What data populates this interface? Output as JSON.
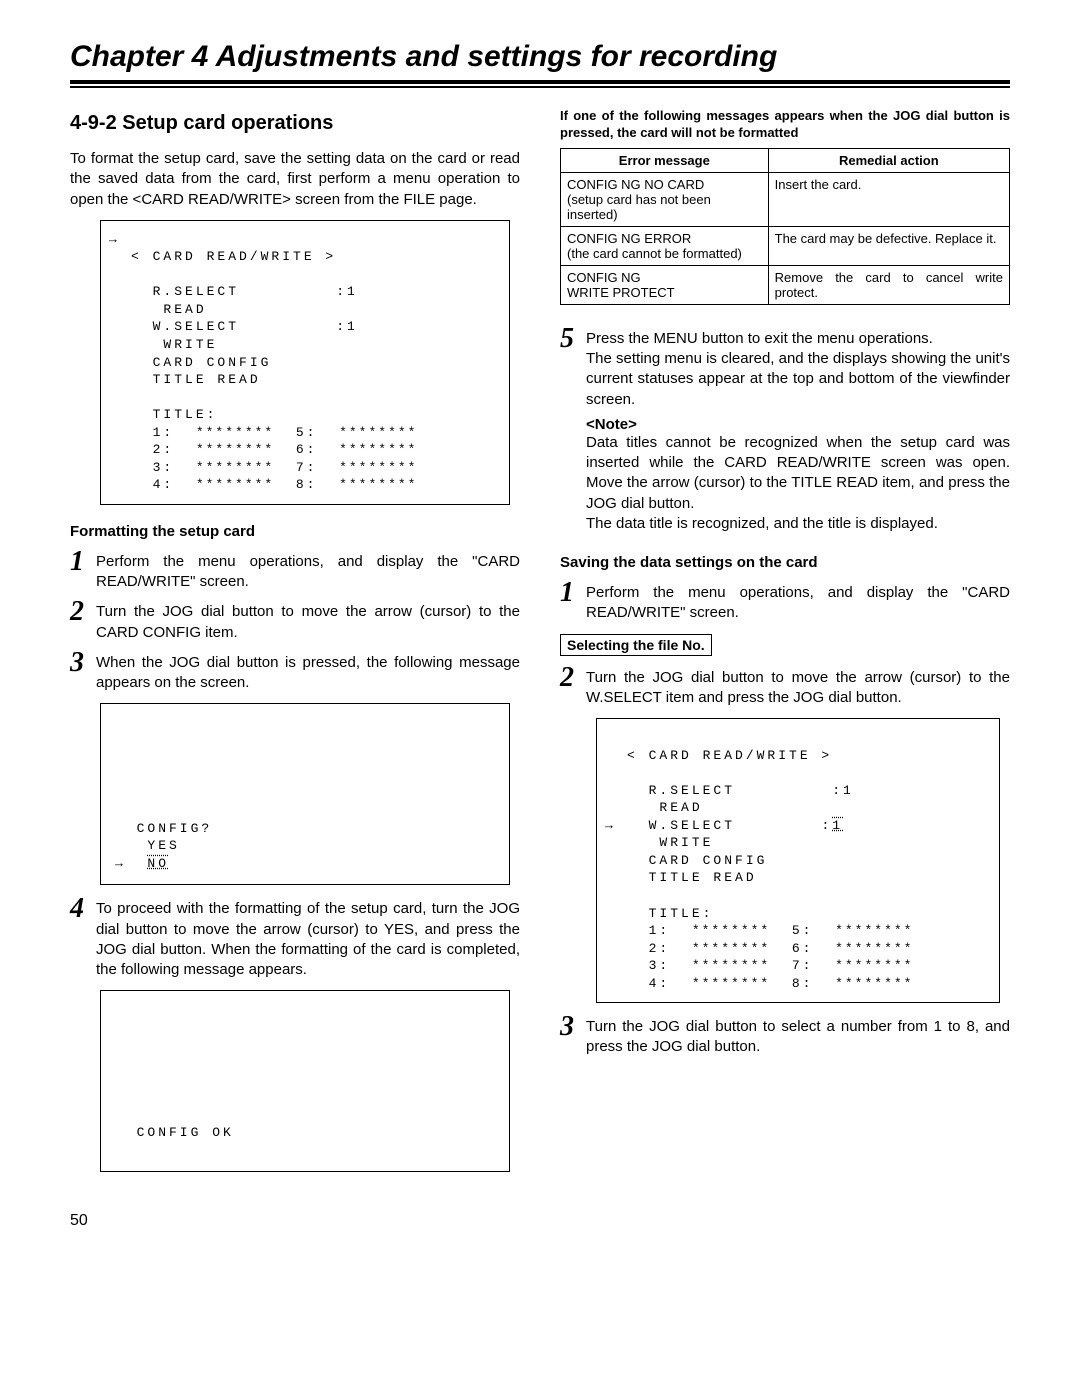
{
  "chapter": "Chapter 4  Adjustments and settings for recording",
  "section": "4-9-2 Setup card operations",
  "intro": "To format the setup card, save the setting data on the card or read the saved data from the card, first perform a menu operation to open the <CARD READ/WRITE> screen from the FILE page.",
  "screen1": {
    "line0": "→< CARD READ/WRITE >",
    "l1": "R.SELECT",
    "v1": ":1",
    "l2": " READ",
    "l3": "W.SELECT",
    "v3": ":1",
    "l4": " WRITE",
    "l5": "CARD CONFIG",
    "l6": "TITLE READ",
    "title": "TITLE:",
    "row1l": "1:  ",
    "ast": "********",
    "row1r": "5:  ",
    "row2l": "2:  ",
    "row2r": "6:  ",
    "row3l": "3:  ",
    "row3r": "7:  ",
    "row4l": "4:  ",
    "row4r": "8:  "
  },
  "fmt_head": "Formatting the setup card",
  "steps_left": {
    "s1": {
      "n": "1",
      "t": "Perform the menu operations, and display the \"CARD READ/WRITE\" screen."
    },
    "s2": {
      "n": "2",
      "t": "Turn the JOG dial button to move the arrow (cursor) to the CARD CONFIG item."
    },
    "s3": {
      "n": "3",
      "t": "When the JOG dial button is pressed, the following message appears on the screen."
    },
    "s4": {
      "n": "4",
      "t": "To proceed with the formatting of the setup card, turn the JOG dial button to move the arrow (cursor) to YES, and press the JOG dial button.  When the formatting of the card is completed, the following message appears."
    }
  },
  "screen_config_q": {
    "l1": "  CONFIG?",
    "l2": "   YES",
    "arrow": "→",
    "no": "NO"
  },
  "screen_config_ok": "  CONFIG OK",
  "table_caption": "If one of the following messages appears when the JOG dial button is pressed, the card will not be formatted",
  "table": {
    "h1": "Error message",
    "h2": "Remedial action",
    "rows": [
      {
        "m1": "CONFIG NG NO CARD",
        "m2": "(setup card has not been inserted)",
        "a": "Insert the card."
      },
      {
        "m1": "CONFIG NG ERROR",
        "m2": "(the card cannot be formatted)",
        "a": "The card may be defective. Replace it."
      },
      {
        "m1": "CONFIG NG",
        "m2": "WRITE PROTECT",
        "a": "Remove the card to cancel write protect."
      }
    ]
  },
  "steps_right": {
    "s5": {
      "n": "5",
      "t": "Press the MENU button to exit the menu operations.\nThe setting menu is cleared, and the displays showing the unit's current statuses appear at the top and bottom of the viewfinder screen."
    }
  },
  "note_head": "<Note>",
  "note_body1": "Data titles cannot be recognized when the setup card was inserted while the CARD READ/WRITE screen was open. Move the arrow (cursor) to the TITLE READ item, and press the JOG dial button.",
  "note_body2": "The data title is recognized, and the title is displayed.",
  "save_head": "Saving the data settings on the card",
  "steps_save": {
    "s1": {
      "n": "1",
      "t": "Perform the menu operations, and display the \"CARD READ/WRITE\" screen."
    }
  },
  "file_no_head": "Selecting the file No.",
  "steps_file": {
    "s2": {
      "n": "2",
      "t": "Turn the JOG dial button to move the arrow (cursor) to the W.SELECT item and press the JOG dial button."
    },
    "s3": {
      "n": "3",
      "t": "Turn the JOG dial button to select a number from 1 to 8, and press the JOG dial button."
    }
  },
  "screen2": {
    "line0": " < CARD READ/WRITE >",
    "l1": "R.SELECT",
    "v1": ":1",
    "arrow": "→",
    "l2": " READ",
    "l3": "W.SELECT",
    "v3": "1",
    "l4": " WRITE",
    "l5": "CARD CONFIG",
    "l6": "TITLE READ"
  },
  "page_num": "50"
}
